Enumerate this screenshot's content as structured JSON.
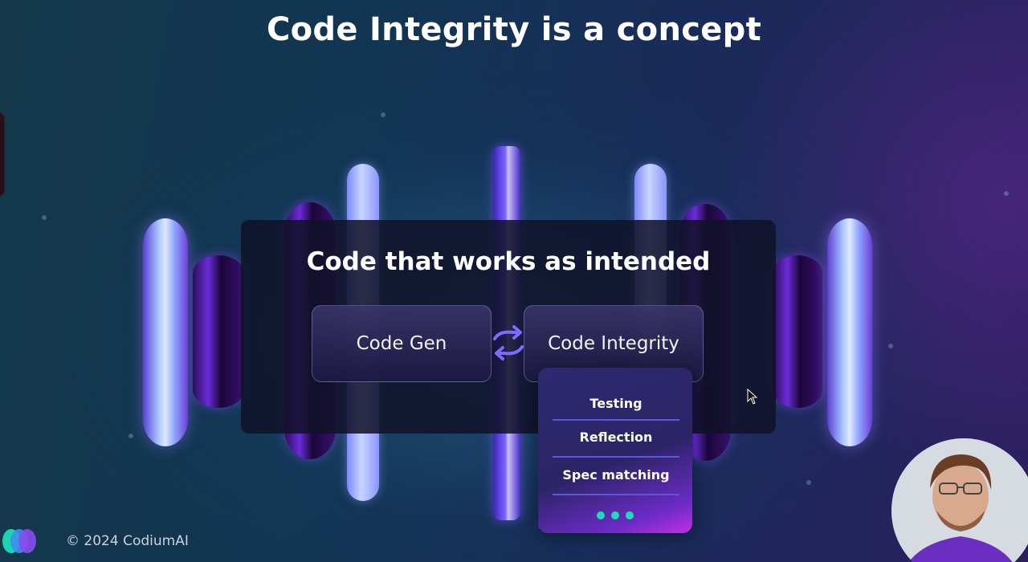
{
  "slide": {
    "title": "Code Integrity is a concept",
    "panel_heading": "Code that works as intended",
    "left_pill": "Code Gen",
    "right_pill": "Code Integrity",
    "card_items": [
      "Testing",
      "Reflection",
      "Spec matching"
    ]
  },
  "footer": {
    "copyright": "© 2024 CodiumAI"
  },
  "colors": {
    "accent_purple": "#7e62ff",
    "card_separator": "#5b57d6",
    "dots_teal": "#19e0b0",
    "card_gradient_end": "#c12fe6"
  },
  "icons": {
    "swap": "swap-arrows-icon",
    "ellipsis": "more-dots-icon",
    "logo": "codiumai-logo-icon",
    "cursor": "mouse-cursor-icon"
  }
}
